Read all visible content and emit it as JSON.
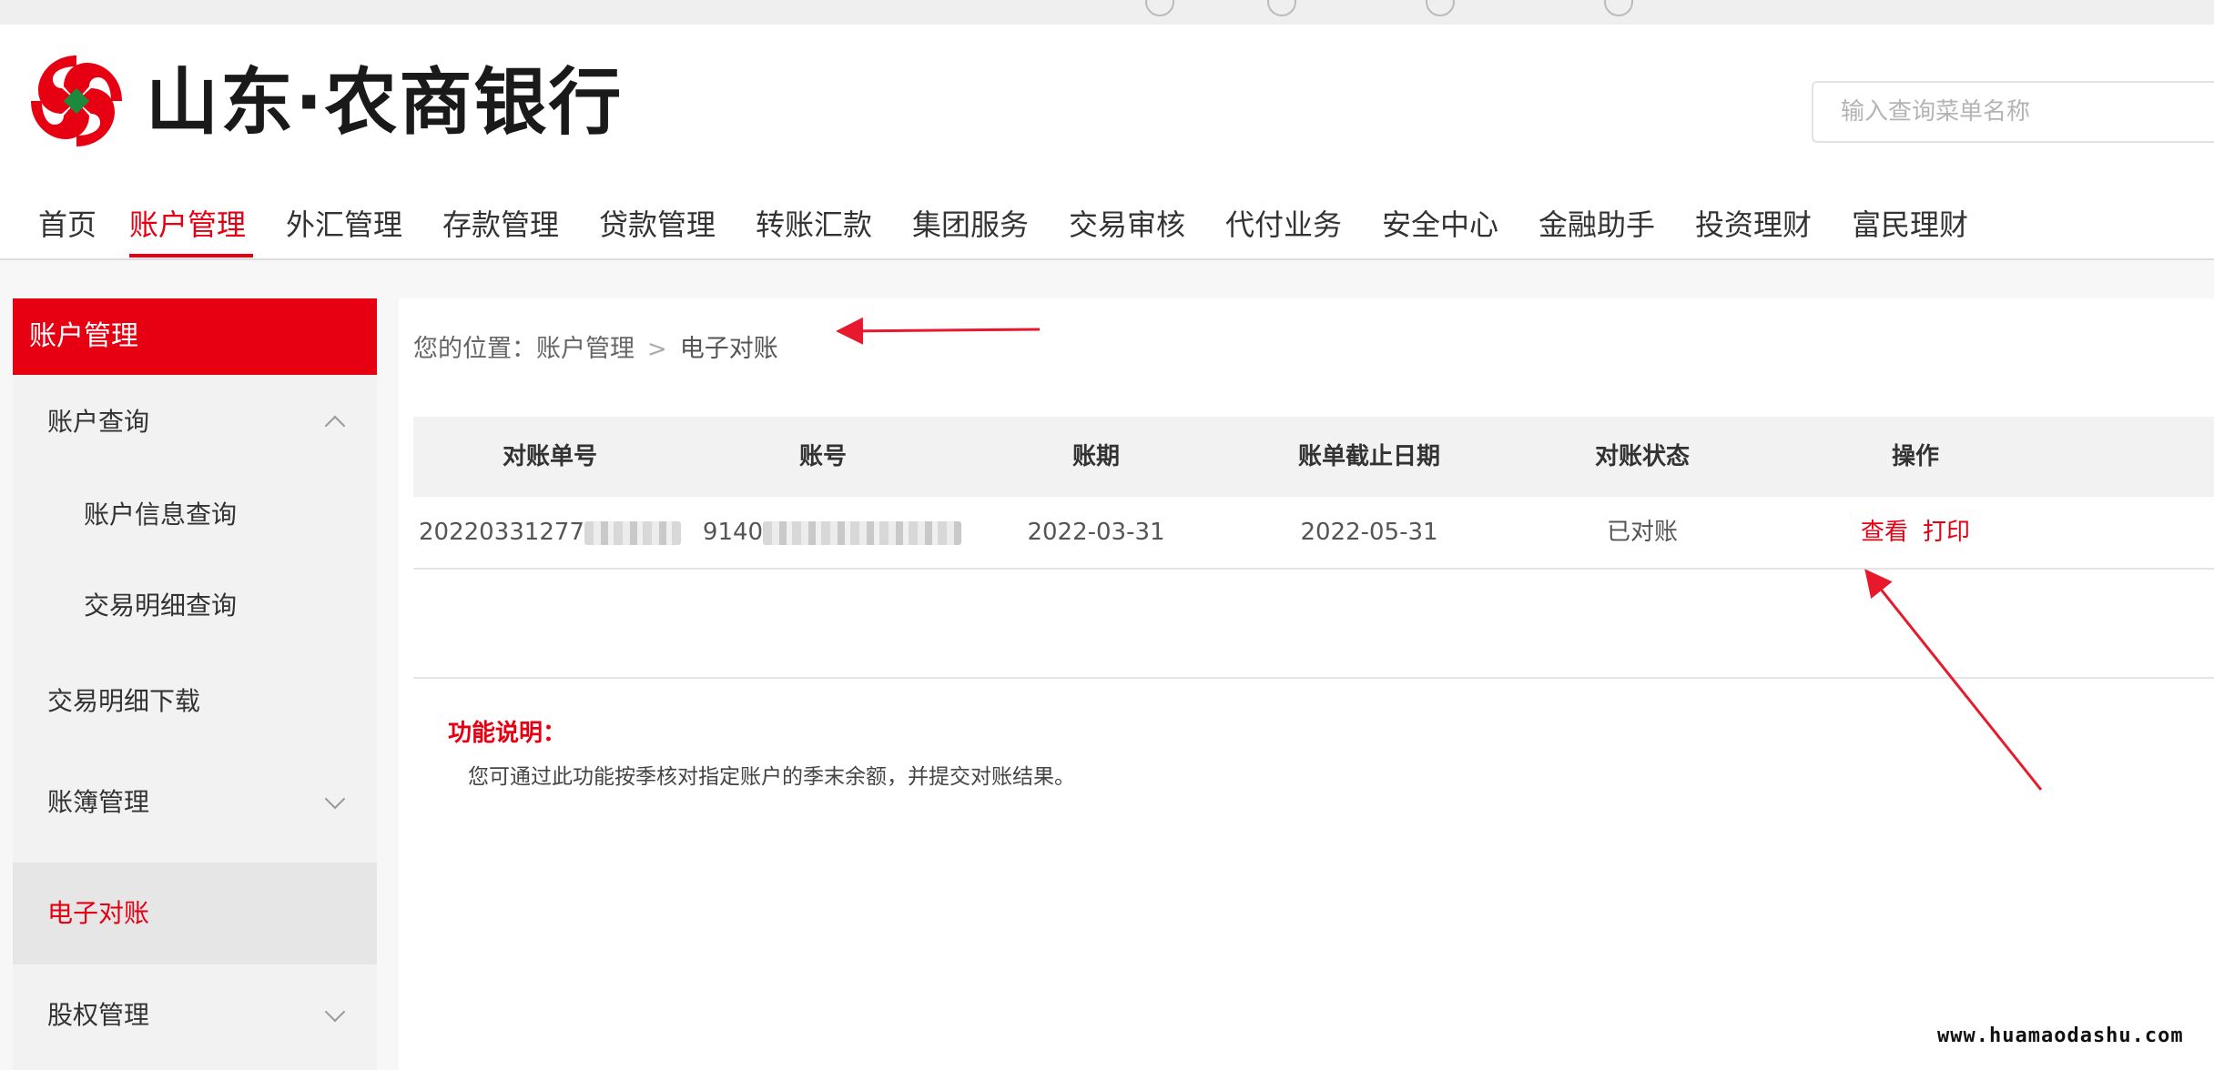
{
  "header": {
    "brand": "山东·农商银行",
    "search_placeholder": "输入查询菜单名称"
  },
  "nav": {
    "items": [
      "首页",
      "账户管理",
      "外汇管理",
      "存款管理",
      "贷款管理",
      "转账汇款",
      "集团服务",
      "交易审核",
      "代付业务",
      "安全中心",
      "金融助手",
      "投资理财",
      "富民理财"
    ],
    "active": "账户管理"
  },
  "sidebar": {
    "title": "账户管理",
    "items": [
      {
        "label": "账户查询"
      },
      {
        "label": "账户信息查询"
      },
      {
        "label": "交易明细查询"
      },
      {
        "label": "交易明细下载"
      },
      {
        "label": "账簿管理"
      },
      {
        "label": "电子对账"
      },
      {
        "label": "股权管理"
      }
    ]
  },
  "breadcrumb": {
    "prefix": "您的位置：",
    "parent": "账户管理",
    "separator": ">",
    "current": "电子对账"
  },
  "table": {
    "columns": [
      "对账单号",
      "账号",
      "账期",
      "账单截止日期",
      "对账状态",
      "操作"
    ],
    "rows": [
      {
        "statement_no_visible": "20220331277",
        "account_visible": "9140",
        "period": "2022-03-31",
        "due_date": "2022-05-31",
        "status": "已对账",
        "actions": [
          "查看",
          "打印"
        ]
      }
    ]
  },
  "note": {
    "title": "功能说明：",
    "text": "您可通过此功能按季核对指定账户的季末余额，并提交对账结果。"
  },
  "watermark": "www.huamaodashu.com",
  "colors": {
    "brand_red": "#e60012",
    "annotation_red": "#e8192c"
  }
}
